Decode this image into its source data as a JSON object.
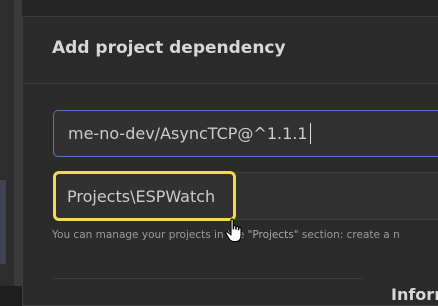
{
  "dialog": {
    "title": "Add project dependency",
    "spec_input": {
      "value": "me-no-dev/AsyncTCP@^1.1.1"
    },
    "storage_field": {
      "value": "Projects\\ESPWatch"
    },
    "help_text": {
      "before": "You can manage your projects in the ",
      "quoted": "\"Projects\"",
      "after": " section: create a n"
    },
    "info_heading": "Inforr"
  },
  "colors": {
    "dialog_bg": "#2b2b2b",
    "focus_border": "#4a78c9",
    "highlight": "#f2d94e",
    "text": "#cccccc"
  },
  "icons": {
    "cursor": "hand-pointer-icon"
  }
}
